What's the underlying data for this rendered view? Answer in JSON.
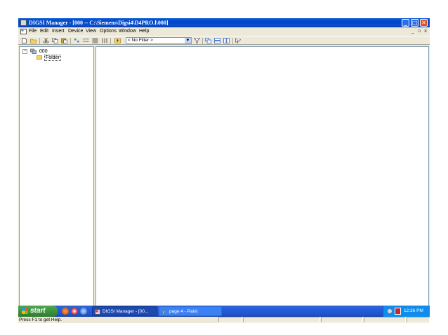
{
  "window": {
    "title": "DIGSI Manager - [000 -- C:\\Siemens\\Digsi4\\D4PRO.l\\000]",
    "controls": {
      "minimize": "_",
      "maximize": "□",
      "close": "✕"
    }
  },
  "menubar": {
    "items": [
      "File",
      "Edit",
      "Insert",
      "Device",
      "View",
      "Options",
      "Window",
      "Help"
    ],
    "mdi_controls": {
      "minimize": "_",
      "restore": "▫",
      "close": "x"
    }
  },
  "toolbar": {
    "filter_value": "< No Filter >",
    "dropdown_arrow": "▼"
  },
  "tree": {
    "root_expander": "−",
    "root_label": "000",
    "child_label": "Folder"
  },
  "statusbar": {
    "text": "Press F1 to get Help."
  },
  "taskbar": {
    "start_label": "start",
    "tasks": [
      "DIGSI Manager - [00...",
      "page 4 - Paint"
    ],
    "clock": "12:36 PM"
  },
  "colors": {
    "title_blue": "#0a5ad6",
    "chrome": "#ece9d8",
    "taskbar_blue": "#245edb",
    "start_green": "#3c8f3c",
    "close_red": "#d9502c"
  }
}
